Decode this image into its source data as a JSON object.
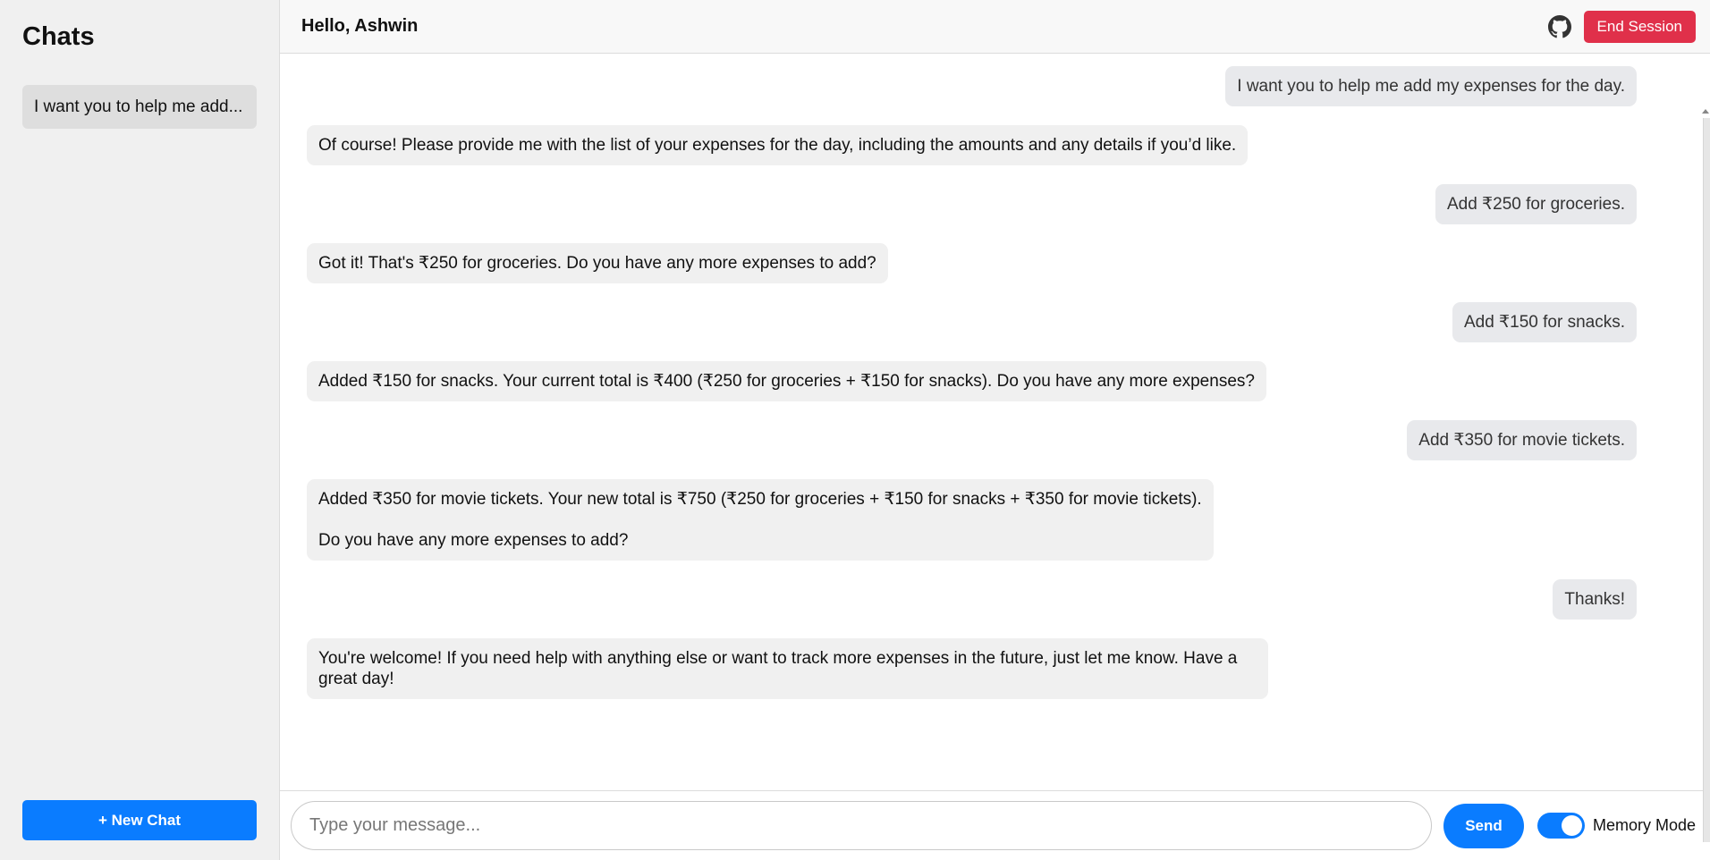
{
  "sidebar": {
    "title": "Chats",
    "items": [
      {
        "label": "I want you to help me add..."
      }
    ],
    "new_chat_label": "+ New Chat"
  },
  "header": {
    "greeting": "Hello, Ashwin",
    "github_icon": "github-icon",
    "end_session_label": "End Session"
  },
  "messages": [
    {
      "role": "user",
      "text": "I want you to help me add my expenses for the day."
    },
    {
      "role": "assistant",
      "text": "Of course! Please provide me with the list of your expenses for the day, including the amounts and any details if you’d like."
    },
    {
      "role": "user",
      "text": "Add ₹250 for groceries."
    },
    {
      "role": "assistant",
      "text": "Got it! That's ₹250 for groceries. Do you have any more expenses to add?"
    },
    {
      "role": "user",
      "text": "Add ₹150 for snacks."
    },
    {
      "role": "assistant",
      "text": "Added ₹150 for snacks. Your current total is ₹400 (₹250 for groceries + ₹150 for snacks). Do you have any more expenses?"
    },
    {
      "role": "user",
      "text": "Add ₹350 for movie tickets."
    },
    {
      "role": "assistant",
      "text": "Added ₹350 for movie tickets. Your new total is ₹750 (₹250 for groceries + ₹150 for snacks + ₹350 for movie tickets).",
      "text2": "Do you have any more expenses to add?"
    },
    {
      "role": "user",
      "text": "Thanks!"
    },
    {
      "role": "assistant",
      "text": "You're welcome! If you need help with anything else or want to track more expenses in the future, just let me know. Have a great day!"
    }
  ],
  "composer": {
    "placeholder": "Type your message...",
    "value": "",
    "send_label": "Send",
    "memory_mode_label": "Memory Mode",
    "memory_mode_on": true
  },
  "colors": {
    "accent": "#0a7cff",
    "danger": "#e0304a",
    "sidebar_bg": "#f0f0f0",
    "bot_bubble": "#f0f0f0",
    "user_bubble": "#e8e9ec"
  }
}
